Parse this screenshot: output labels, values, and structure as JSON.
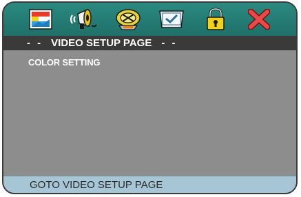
{
  "icons": [
    {
      "name": "general-setup-icon",
      "selected": true
    },
    {
      "name": "audio-setup-icon",
      "selected": false
    },
    {
      "name": "dolby-setup-icon",
      "selected": false
    },
    {
      "name": "preference-setup-icon",
      "selected": false
    },
    {
      "name": "password-setup-icon",
      "selected": false
    },
    {
      "name": "exit-icon",
      "selected": false
    }
  ],
  "title": {
    "left_dashes": "- -",
    "text": "VIDEO SETUP PAGE",
    "right_dashes": "- -"
  },
  "menu": {
    "items": [
      {
        "label": "COLOR SETTING"
      }
    ]
  },
  "status": {
    "text": "GOTO VIDEO SETUP PAGE"
  },
  "colors": {
    "icon_bar": "#2a8a80",
    "title_bar": "#3a3a3a",
    "content_bg": "#8d8d8d",
    "status_bar": "#a6c6d6"
  }
}
